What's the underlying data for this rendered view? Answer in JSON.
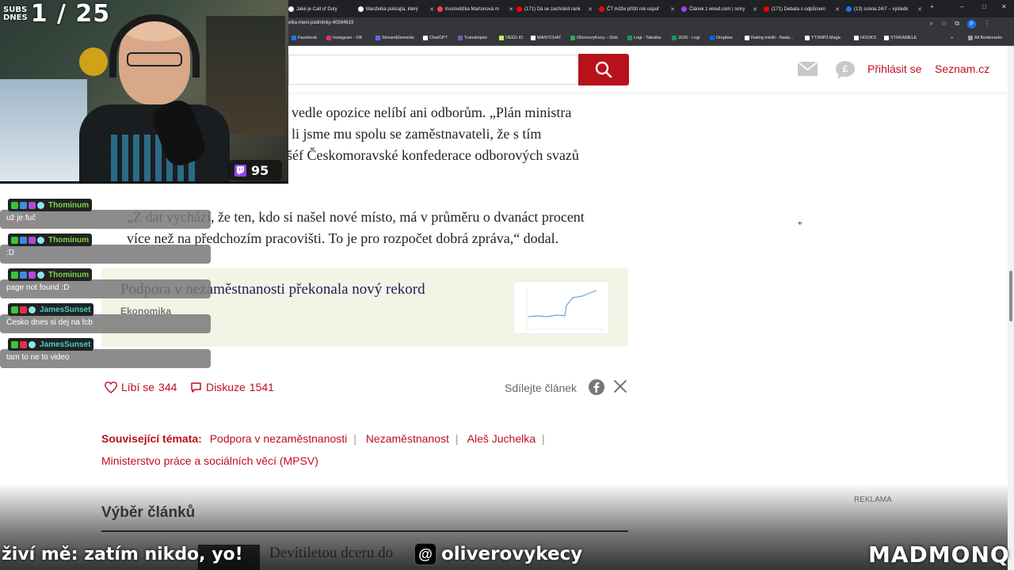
{
  "browser": {
    "tabs": [
      {
        "title": "Jaké je Call of Duty",
        "color": "#ffffff"
      },
      {
        "title": "Manželka policajta, který",
        "color": "#ffffff"
      },
      {
        "title": "Kosmetička Martonová m",
        "color": "#ff4444"
      },
      {
        "title": "(171) Dá se zachránit rank",
        "color": "#ff0000"
      },
      {
        "title": "ČT může příští rok uspoř",
        "color": "#ff0000"
      },
      {
        "title": "Článek z wired.com | smry",
        "color": "#a142f4"
      },
      {
        "title": "(171) Debata s odpůrcem",
        "color": "#ff0000"
      },
      {
        "title": "(13) scéna 24/7 – výsledk",
        "color": "#1877f2"
      }
    ],
    "url": "elka-meni-podminky-40594619",
    "profile_initial": "P",
    "bookmarks": [
      {
        "label": "Facebook",
        "color": "#1877f2"
      },
      {
        "label": "Instagram - OK",
        "color": "#e1306c"
      },
      {
        "label": "StreamElements",
        "color": "#5a6bff"
      },
      {
        "label": "ChatGPT",
        "color": "#ffffff"
      },
      {
        "label": "Transkriptor",
        "color": "#7e57c2"
      },
      {
        "label": "VEED.IO",
        "color": "#bdf75d"
      },
      {
        "label": "MANYCHAT",
        "color": "#ffffff"
      },
      {
        "label": "OliverovyKecy – Disk",
        "color": "#34a853"
      },
      {
        "label": "Logi - Tabulka",
        "color": "#0f9d58"
      },
      {
        "label": "2026 - Logi",
        "color": "#0f9d58"
      },
      {
        "label": "Dropbox",
        "color": "#0061ff"
      },
      {
        "label": "Rating médií - Nada...",
        "color": "#ffffff"
      },
      {
        "label": "YT2MP3 Magic",
        "color": "#ffffff"
      },
      {
        "label": "HOOKS",
        "color": "#ffffff"
      },
      {
        "label": "STREAMELE",
        "color": "#ffffff"
      }
    ],
    "all_bookmarks": "All Bookmarks"
  },
  "header": {
    "search_value": "",
    "login_label": "Přihlásit se",
    "seznam_label": "Seznam.cz"
  },
  "article": {
    "para1": [
      "vedle opozice nelíbí ani odborům. „Plán ministra",
      "li jsme mu spolu se zaměstnavateli, že s tím",
      "šéf Českomoravské konfederace odborových svazů"
    ],
    "para2": [
      "„Z dat vychází, že ten, kdo si našel nové místo, má v průměru o dvanáct procent",
      "více než na předchozím pracovišti. To je pro rozpočet dobrá zpráva,“ dodal."
    ],
    "related": {
      "title": "Podpora v nezaměstnanosti překonala nový rekord",
      "category": "Ekonomika"
    },
    "likes_label": "Líbí se",
    "likes_count": "344",
    "discussion_label": "Diskuze",
    "discussion_count": "1541",
    "share_label": "Sdílejte článek",
    "topics_label": "Související témata:",
    "topics": [
      "Podpora v nezaměstnanosti",
      "Nezaměstnanost",
      "Aleš Juchelka",
      "Ministerstvo práce a sociálních věcí (MPSV)"
    ],
    "reklama": "REKLAMA",
    "section_title": "Výběr článků",
    "teaser": "Devítiletou dceru do"
  },
  "stream": {
    "subs_badge_line1": "SUBS",
    "subs_badge_line2": "DNES",
    "subs_count": "1 / 25",
    "viewers": "95",
    "chat": [
      {
        "user": "Thominum",
        "color": "#7fd44a",
        "text": "už je fuč"
      },
      {
        "user": "Thominum",
        "color": "#7fd44a",
        "text": ":D"
      },
      {
        "user": "Thominum",
        "color": "#7fd44a",
        "text": "page not found :D"
      },
      {
        "user": "JamesSunset",
        "color": "#3fd1c5",
        "text": "Česko dnes si dej na fcb"
      },
      {
        "user": "JamesSunset",
        "color": "#3fd1c5",
        "text": "tam to ne to video"
      }
    ],
    "ticker": "živí mě: zatím nikdo, yo!",
    "handle": "oliverovykecy",
    "brand": "MADMONQ"
  },
  "colors": {
    "accent_red": "#c00d1e",
    "search_red": "#b5121b",
    "related_bg": "#f4f4e6"
  }
}
